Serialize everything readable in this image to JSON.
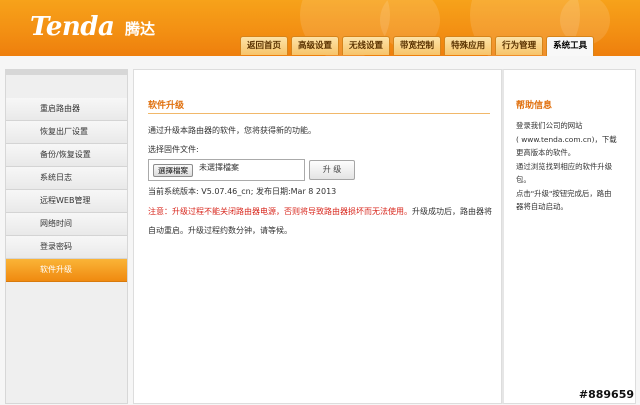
{
  "header": {
    "logo": "Tenda",
    "logo_cn": "腾达",
    "tabs": [
      "返回首页",
      "高级设置",
      "无线设置",
      "带宽控制",
      "特殊应用",
      "行为管理",
      "系统工具"
    ]
  },
  "sidebar": {
    "items": [
      "重启路由器",
      "恢复出厂设置",
      "备份/恢复设置",
      "系统日志",
      "远程WEB管理",
      "网络时间",
      "登录密码",
      "软件升级"
    ]
  },
  "main": {
    "title": "软件升级",
    "description": "通过升级本路由器的软件，您将获得新的功能。",
    "file_label": "选择固件文件:",
    "choose_button": "選擇檔案",
    "file_status": "未選擇檔案",
    "upgrade_button": "升 级",
    "version_info": "当前系统版本: V5.07.46_cn; 发布日期:Mar 8 2013",
    "warning_red": "注意：升级过程不能关闭路由器电源，否则将导致路由器损坏而无法使用。",
    "warning_tail": "升级成功后，路由器将",
    "note_line2": "自动重启。升级过程约数分钟，请等候。"
  },
  "help": {
    "title": "帮助信息",
    "lines": [
      "登录我们公司的网站",
      "( www.tenda.com.cn)，下载",
      "更高版本的软件。",
      "通过浏览找到相应的软件升级",
      "包。",
      "点击\"升级\"按钮完成后，路由",
      "器将自动启动。"
    ]
  },
  "watermark": "#889659"
}
